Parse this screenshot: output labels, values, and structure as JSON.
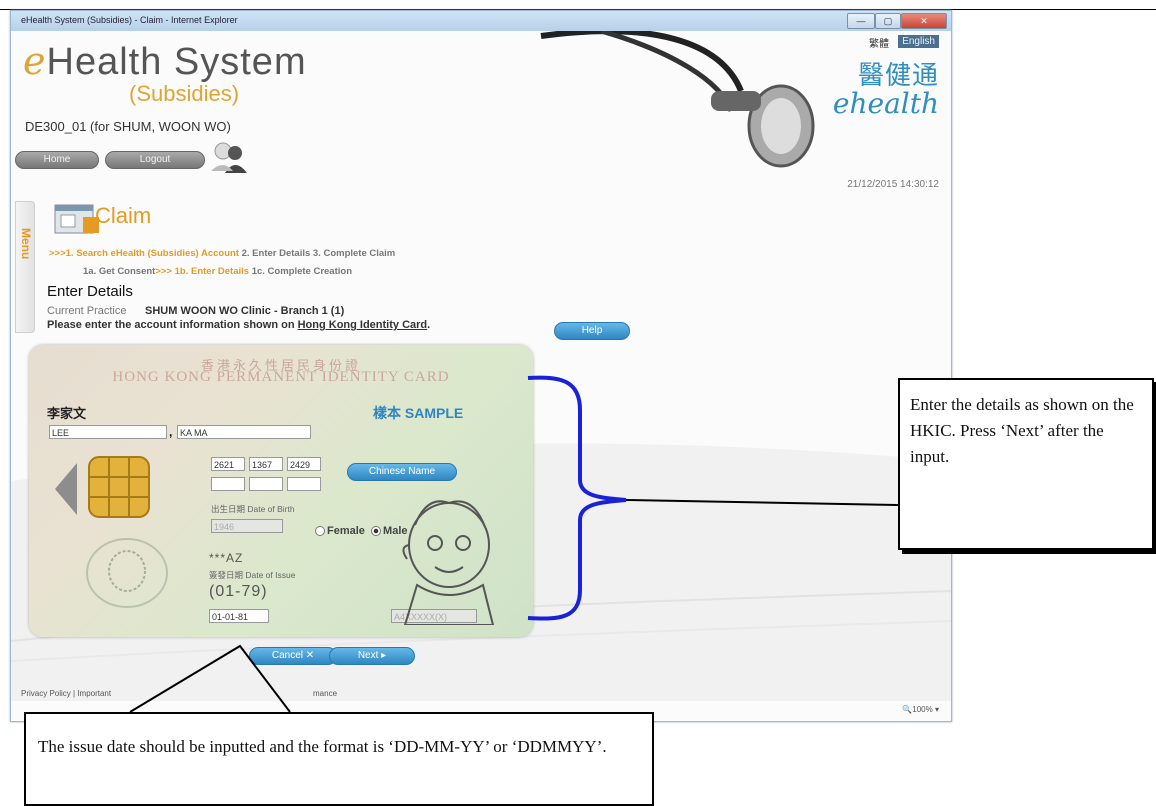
{
  "window": {
    "title": "eHealth System (Subsidies) - Claim - Internet Explorer",
    "controls": [
      "—",
      "▢",
      "✕"
    ]
  },
  "header": {
    "logo_main": "Health System",
    "logo_e": "e",
    "logo_sub": "(Subsidies)",
    "user": "DE300_01 (for SHUM, WOON WO)",
    "home_label": "Home",
    "logout_label": "Logout",
    "lang_chinese": "繁體",
    "lang_english": "English",
    "brand_cn": "醫健通",
    "brand_en": "ehealth",
    "datetime": "21/12/2015 14:30:12"
  },
  "sidebar": {
    "menu_label": "Menu"
  },
  "claim": {
    "title": "Claim",
    "steps_row1": {
      "active": ">>>1. Search eHealth (Subsidies) Account",
      "rest": " 2. Enter Details  3. Complete Claim"
    },
    "steps_row2": {
      "first": "1a. Get Consent",
      "active": ">>>  1b. Enter Details",
      "rest": "  1c. Complete Creation"
    },
    "section_title": "Enter Details",
    "practice_label": "Current Practice",
    "practice_value": "SHUM WOON WO Clinic - Branch 1 (1)",
    "instruction_prefix": "Please enter the account information shown on ",
    "instruction_link": "Hong Kong Identity Card",
    "instruction_suffix": ".",
    "help_label": "Help"
  },
  "card": {
    "title_cn": "香港永久性居民身份證",
    "title_en": "HONG KONG PERMANENT IDENTITY CARD",
    "name_cn": "李家文",
    "sample": "樣本 SAMPLE",
    "surname": "LEE",
    "given_name": "KA MA",
    "ccc": [
      "2621",
      "1367",
      "2429",
      "",
      "",
      ""
    ],
    "chinese_name_label": "Chinese Name",
    "dob_label": "出生日期 Date of Birth",
    "dob_value": "1946",
    "female_label": "Female",
    "male_label": "Male",
    "gender_selected": "Male",
    "symbols": "***AZ",
    "doi_label": "簽發日期 Date of Issue",
    "doi_code": "(01-79)",
    "doi_value": "01-01-81",
    "hkid_value": "A4XXXXX(X)"
  },
  "actions": {
    "cancel_label": "Cancel",
    "next_label": "Next"
  },
  "footer": {
    "left": "Privacy Policy | Important",
    "right": "mance",
    "zoom": "100%"
  },
  "callouts": {
    "right": "Enter the details as shown on the HKIC. Press ‘Next’ after the input.",
    "bottom": "The issue date should be inputted and the format is ‘DD-MM-YY’ or ‘DDMMYY’."
  },
  "colors": {
    "accent_orange": "#e59b21",
    "button_blue": "#2f86c2",
    "brace_blue": "#1a22d8",
    "brand_blue": "#2f8ec0"
  }
}
